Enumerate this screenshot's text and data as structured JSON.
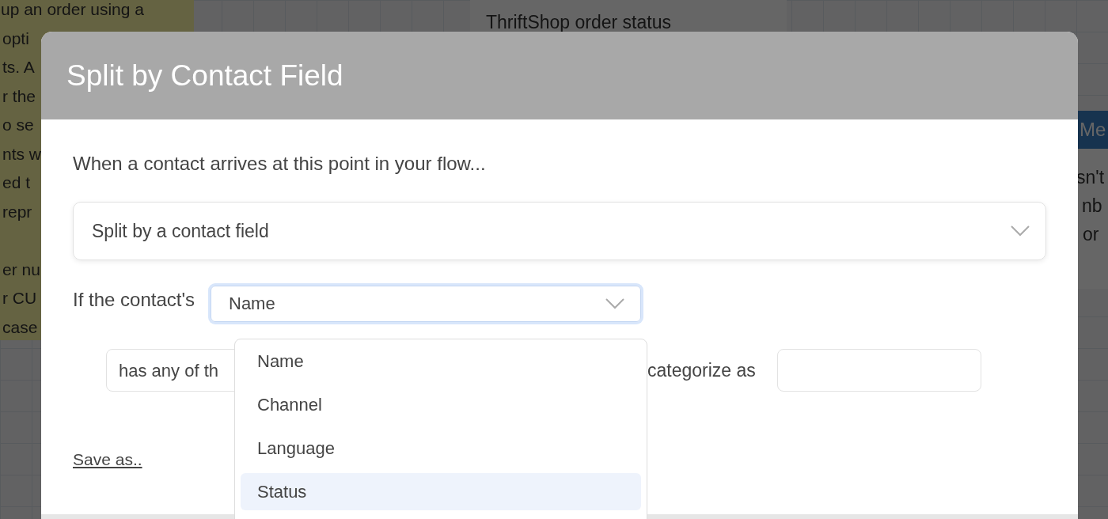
{
  "background": {
    "note_paragraphs": [
      [
        "up an order using a",
        "opti",
        "ts. A",
        "r the",
        "o se",
        "nts w",
        "ed t",
        "repr"
      ],
      [
        "er nu",
        "r CU",
        "case"
      ]
    ],
    "node_text": "ThriftShop order status",
    "right_node": {
      "header": "Me",
      "lines": [
        "sn't",
        "nb",
        "or"
      ]
    }
  },
  "dialog": {
    "title": "Split by Contact Field",
    "intro": "When a contact arrives at this point in your flow...",
    "split_select": {
      "value": "Split by a contact field"
    },
    "field_label": "If the contact's",
    "field_select": {
      "value": "Name",
      "expanded": true
    },
    "rule": {
      "operator_value": "has any of th",
      "categorize_label": "categorize as"
    },
    "save_link": "Save as..",
    "options": [
      {
        "label": "Name",
        "selected": false
      },
      {
        "label": "Channel",
        "selected": false
      },
      {
        "label": "Language",
        "selected": false
      },
      {
        "label": "Status",
        "selected": true
      }
    ]
  }
}
